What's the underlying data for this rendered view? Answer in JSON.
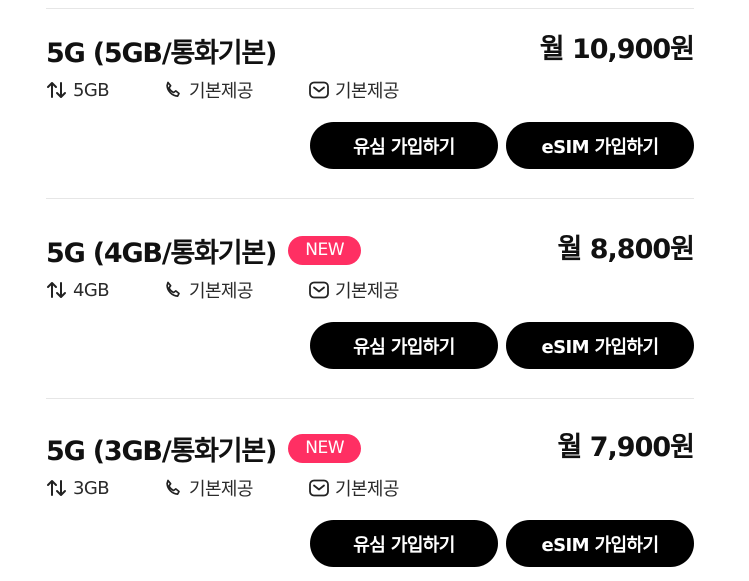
{
  "plans": [
    {
      "title": "5G (5GB/통화기본)",
      "badge": "",
      "price": "월 10,900원",
      "data": "5GB",
      "call": "기본제공",
      "sms": "기본제공",
      "usim_button": "유심 가입하기",
      "esim_button": "eSIM 가입하기"
    },
    {
      "title": "5G (4GB/통화기본)",
      "badge": "NEW",
      "price": "월 8,800원",
      "data": "4GB",
      "call": "기본제공",
      "sms": "기본제공",
      "usim_button": "유심 가입하기",
      "esim_button": "eSIM 가입하기"
    },
    {
      "title": "5G (3GB/통화기본)",
      "badge": "NEW",
      "price": "월 7,900원",
      "data": "3GB",
      "call": "기본제공",
      "sms": "기본제공",
      "usim_button": "유심 가입하기",
      "esim_button": "eSIM 가입하기"
    }
  ],
  "icons": {
    "data": "data-transfer-icon",
    "call": "phone-icon",
    "sms": "message-icon"
  },
  "colors": {
    "badge": "#ff2f63",
    "button": "#000000",
    "divider": "#e6e6e6"
  }
}
